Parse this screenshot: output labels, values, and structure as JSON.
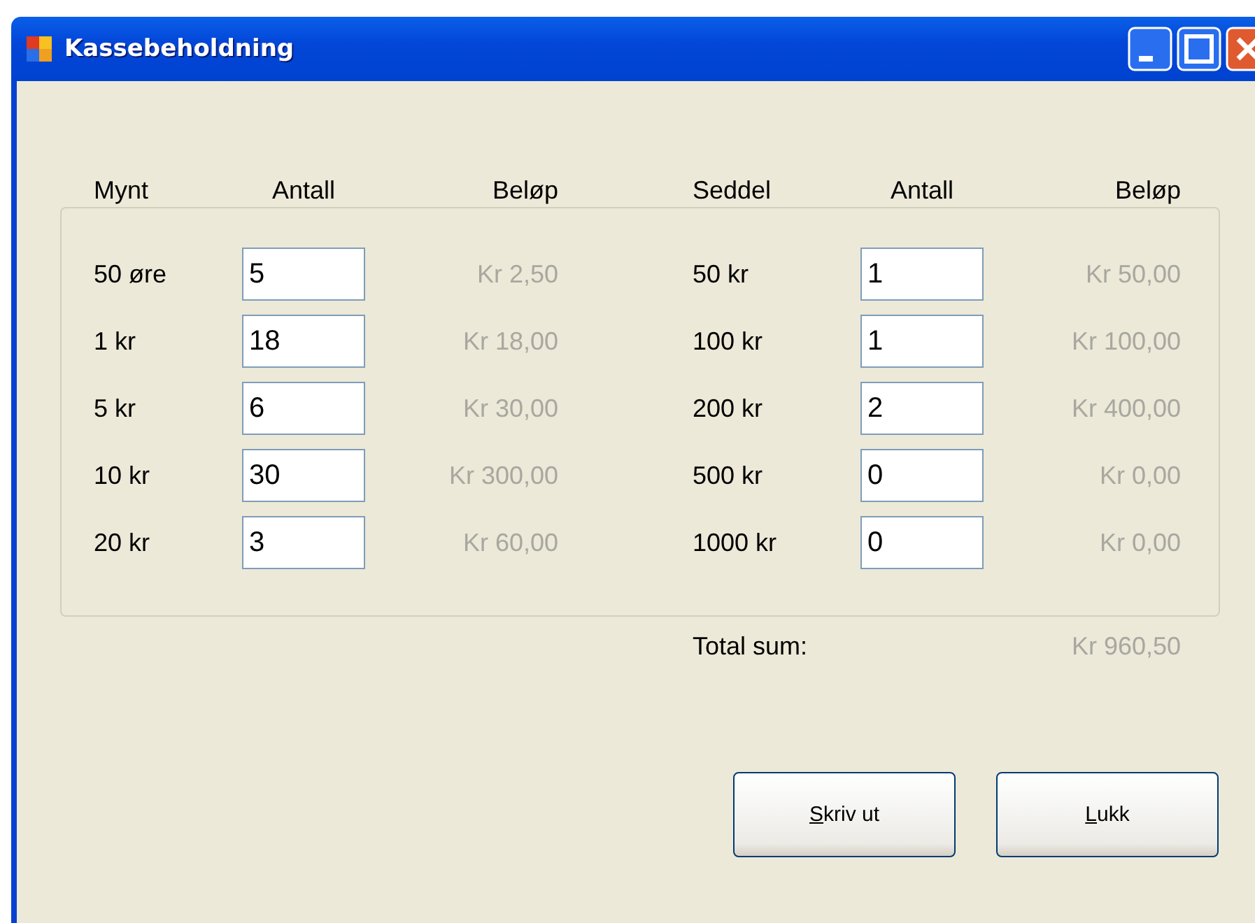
{
  "window": {
    "title": "Kassebeholdning"
  },
  "coins": {
    "headers": [
      "Mynt",
      "Antall",
      "Beløp"
    ],
    "rows": [
      {
        "label": "50 øre",
        "count": "5",
        "amount": "Kr 2,50"
      },
      {
        "label": "1 kr",
        "count": "18",
        "amount": "Kr 18,00"
      },
      {
        "label": "5 kr",
        "count": "6",
        "amount": "Kr 30,00"
      },
      {
        "label": "10 kr",
        "count": "30",
        "amount": "Kr 300,00"
      },
      {
        "label": "20 kr",
        "count": "3",
        "amount": "Kr 60,00"
      }
    ]
  },
  "notes": {
    "headers": [
      "Seddel",
      "Antall",
      "Beløp"
    ],
    "rows": [
      {
        "label": "50 kr",
        "count": "1",
        "amount": "Kr 50,00"
      },
      {
        "label": "100 kr",
        "count": "1",
        "amount": "Kr 100,00"
      },
      {
        "label": "200 kr",
        "count": "2",
        "amount": "Kr 400,00"
      },
      {
        "label": "500 kr",
        "count": "0",
        "amount": "Kr 0,00"
      },
      {
        "label": "1000 kr",
        "count": "0",
        "amount": "Kr 0,00"
      }
    ]
  },
  "total": {
    "label": "Total sum:",
    "amount": "Kr 960,50"
  },
  "buttons": [
    {
      "label": "Skriv ut",
      "underline_first": true
    },
    {
      "label": "Lukk",
      "underline_first": true
    }
  ]
}
